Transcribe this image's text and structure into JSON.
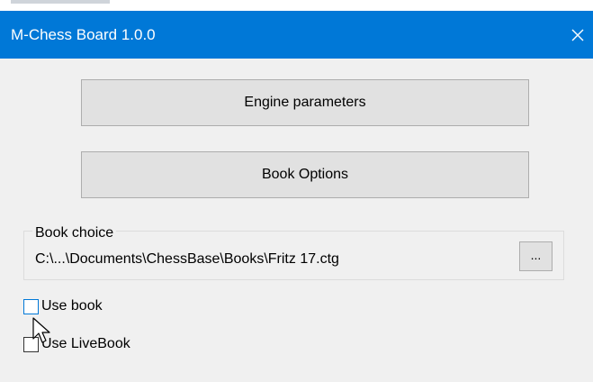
{
  "window": {
    "title": "M-Chess Board 1.0.0",
    "close_glyph": "✕"
  },
  "buttons": {
    "engine_parameters": "Engine parameters",
    "book_options": "Book Options"
  },
  "book_choice": {
    "legend": "Book choice",
    "path": "C:\\...\\Documents\\ChessBase\\Books\\Fritz 17.ctg",
    "browse_label": "..."
  },
  "checkboxes": {
    "use_book": {
      "label": "Use book",
      "checked": false
    },
    "use_livebook": {
      "label": "Use LiveBook",
      "checked": false
    }
  },
  "colors": {
    "titlebar": "#0078d7",
    "window_bg": "#f0f0f0",
    "button_bg": "#e1e1e1",
    "button_border": "#adadad",
    "focus_accent": "#0078d7"
  },
  "icons": {
    "close": "close-icon",
    "cursor": "mouse-pointer-icon"
  }
}
